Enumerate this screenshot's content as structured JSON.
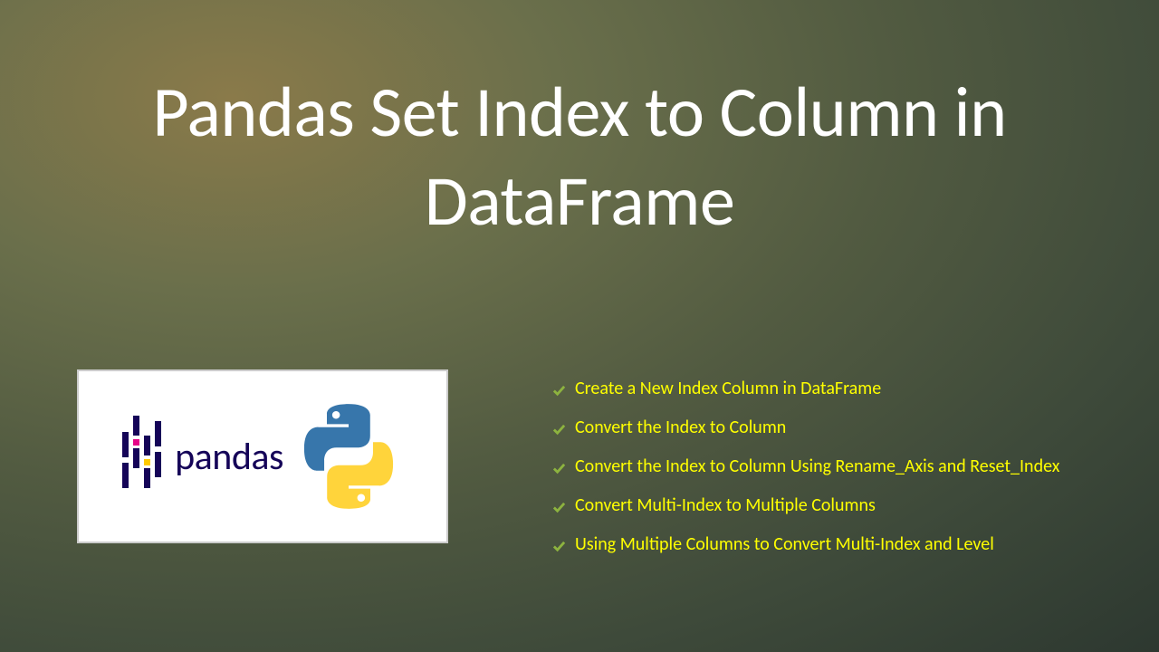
{
  "title": "Pandas Set Index to Column in DataFrame",
  "pandas_text": "pandas",
  "bullets": [
    "Create a New Index Column in DataFrame",
    "Convert the Index to Column",
    "Convert the Index to Column Using Rename_Axis and Reset_Index",
    "Convert Multi-Index to Multiple Columns",
    "Using Multiple Columns to Convert Multi-Index and Level"
  ]
}
